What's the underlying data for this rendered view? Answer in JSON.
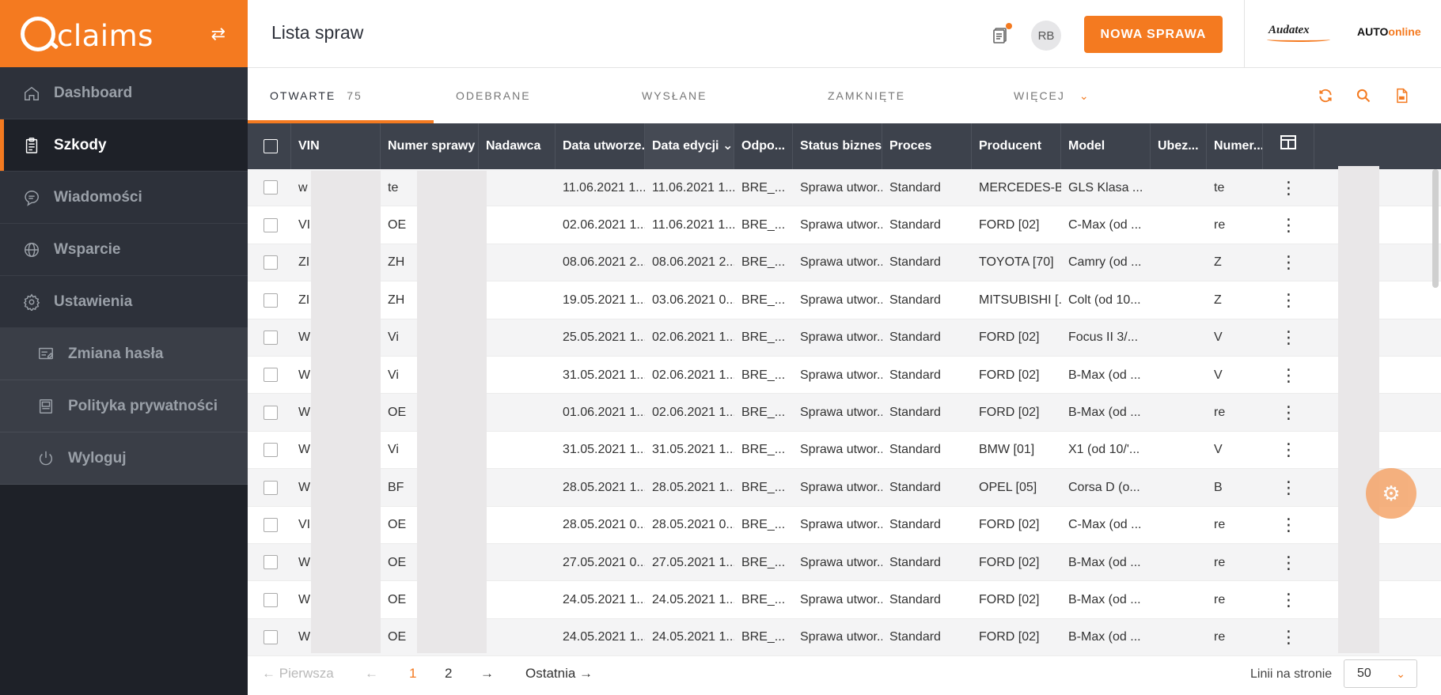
{
  "app": {
    "logo_text": "claims"
  },
  "sidebar": {
    "items": [
      {
        "label": "Dashboard",
        "icon": "home-icon"
      },
      {
        "label": "Szkody",
        "icon": "clipboard-icon",
        "active": true
      },
      {
        "label": "Wiadomości",
        "icon": "chat-icon"
      },
      {
        "label": "Wsparcie",
        "icon": "globe-icon"
      },
      {
        "label": "Ustawienia",
        "icon": "gear-icon"
      },
      {
        "label": "Zmiana hasła",
        "icon": "form-icon",
        "sub": true
      },
      {
        "label": "Polityka prywatności",
        "icon": "document-icon",
        "sub": true
      },
      {
        "label": "Wyloguj",
        "icon": "power-icon",
        "sub": true
      }
    ]
  },
  "header": {
    "title": "Lista spraw",
    "avatar": "RB",
    "new_button": "NOWA SPRAWA",
    "brand_audatex": "Audatex",
    "brand_auto": "AUTO",
    "brand_online": "online"
  },
  "tabs": {
    "open_label": "OTWARTE",
    "open_count": "75",
    "received": "ODEBRANE",
    "sent": "WYSŁANE",
    "closed": "ZAMKNIĘTE",
    "more": "WIĘCEJ"
  },
  "table": {
    "columns": [
      "VIN",
      "Numer sprawy",
      "Nadawca",
      "Data utworze...",
      "Data edycji",
      "Odpo...",
      "Status biznes...",
      "Proces",
      "Producent",
      "Model",
      "Ubez...",
      "Numer..."
    ],
    "rows": [
      {
        "vin": "w",
        "num": "te",
        "sender": "",
        "created": "11.06.2021 1...",
        "edited": "11.06.2021 1...",
        "resp": "BRE_...",
        "status": "Sprawa utwor...",
        "process": "Standard",
        "maker": "MERCEDES-B...",
        "model": "GLS Klasa ...",
        "ins": "",
        "number": "te"
      },
      {
        "vin": "VI",
        "num": "OE",
        "sender": "",
        "created": "02.06.2021 1...",
        "edited": "11.06.2021 1...",
        "resp": "BRE_...",
        "status": "Sprawa utwor...",
        "process": "Standard",
        "maker": "FORD [02]",
        "model": "C-Max (od ...",
        "ins": "",
        "number": "re"
      },
      {
        "vin": "ZI",
        "num": "ZH",
        "sender": "",
        "created": "08.06.2021 2...",
        "edited": "08.06.2021 2...",
        "resp": "BRE_...",
        "status": "Sprawa utwor...",
        "process": "Standard",
        "maker": "TOYOTA [70]",
        "model": "Camry (od ...",
        "ins": "",
        "number": "Z"
      },
      {
        "vin": "ZI",
        "num": "ZH",
        "sender": "",
        "created": "19.05.2021 1...",
        "edited": "03.06.2021 0...",
        "resp": "BRE_...",
        "status": "Sprawa utwor...",
        "process": "Standard",
        "maker": "MITSUBISHI [...",
        "model": "Colt (od 10...",
        "ins": "",
        "number": "Z"
      },
      {
        "vin": "W",
        "num": "Vi",
        "sender": "",
        "created": "25.05.2021 1...",
        "edited": "02.06.2021 1...",
        "resp": "BRE_...",
        "status": "Sprawa utwor...",
        "process": "Standard",
        "maker": "FORD [02]",
        "model": "Focus II 3/...",
        "ins": "",
        "number": "V"
      },
      {
        "vin": "W",
        "num": "Vi",
        "sender": "",
        "created": "31.05.2021 1...",
        "edited": "02.06.2021 1...",
        "resp": "BRE_...",
        "status": "Sprawa utwor...",
        "process": "Standard",
        "maker": "FORD [02]",
        "model": "B-Max (od ...",
        "ins": "",
        "number": "V"
      },
      {
        "vin": "W",
        "num": "OE",
        "sender": "",
        "created": "01.06.2021 1...",
        "edited": "02.06.2021 1...",
        "resp": "BRE_...",
        "status": "Sprawa utwor...",
        "process": "Standard",
        "maker": "FORD [02]",
        "model": "B-Max (od ...",
        "ins": "",
        "number": "re"
      },
      {
        "vin": "W",
        "num": "Vi",
        "sender": "",
        "created": "31.05.2021 1...",
        "edited": "31.05.2021 1...",
        "resp": "BRE_...",
        "status": "Sprawa utwor...",
        "process": "Standard",
        "maker": "BMW [01]",
        "model": "X1 (od 10/'...",
        "ins": "",
        "number": "V"
      },
      {
        "vin": "W",
        "num": "BF",
        "sender": "",
        "created": "28.05.2021 1...",
        "edited": "28.05.2021 1...",
        "resp": "BRE_...",
        "status": "Sprawa utwor...",
        "process": "Standard",
        "maker": "OPEL [05]",
        "model": "Corsa D (o...",
        "ins": "",
        "number": "B"
      },
      {
        "vin": "VI",
        "num": "OE",
        "sender": "",
        "created": "28.05.2021 0...",
        "edited": "28.05.2021 0...",
        "resp": "BRE_...",
        "status": "Sprawa utwor...",
        "process": "Standard",
        "maker": "FORD [02]",
        "model": "C-Max (od ...",
        "ins": "",
        "number": "re"
      },
      {
        "vin": "W",
        "num": "OE",
        "sender": "",
        "created": "27.05.2021 0...",
        "edited": "27.05.2021 1...",
        "resp": "BRE_...",
        "status": "Sprawa utwor...",
        "process": "Standard",
        "maker": "FORD [02]",
        "model": "B-Max (od ...",
        "ins": "",
        "number": "re"
      },
      {
        "vin": "W",
        "num": "OE",
        "sender": "",
        "created": "24.05.2021 1...",
        "edited": "24.05.2021 1...",
        "resp": "BRE_...",
        "status": "Sprawa utwor...",
        "process": "Standard",
        "maker": "FORD [02]",
        "model": "B-Max (od ...",
        "ins": "",
        "number": "re"
      },
      {
        "vin": "W",
        "num": "OE",
        "sender": "",
        "created": "24.05.2021 1...",
        "edited": "24.05.2021 1...",
        "resp": "BRE_...",
        "status": "Sprawa utwor...",
        "process": "Standard",
        "maker": "FORD [02]",
        "model": "B-Max (od ...",
        "ins": "",
        "number": "re"
      }
    ]
  },
  "pagination": {
    "first": "Pierwsza",
    "page1": "1",
    "page2": "2",
    "last": "Ostatnia",
    "rows_label": "Linii na stronie",
    "rows_value": "50"
  },
  "colors": {
    "accent": "#f47a20",
    "sidebar": "#1e2128",
    "table_header": "#3d424c"
  }
}
